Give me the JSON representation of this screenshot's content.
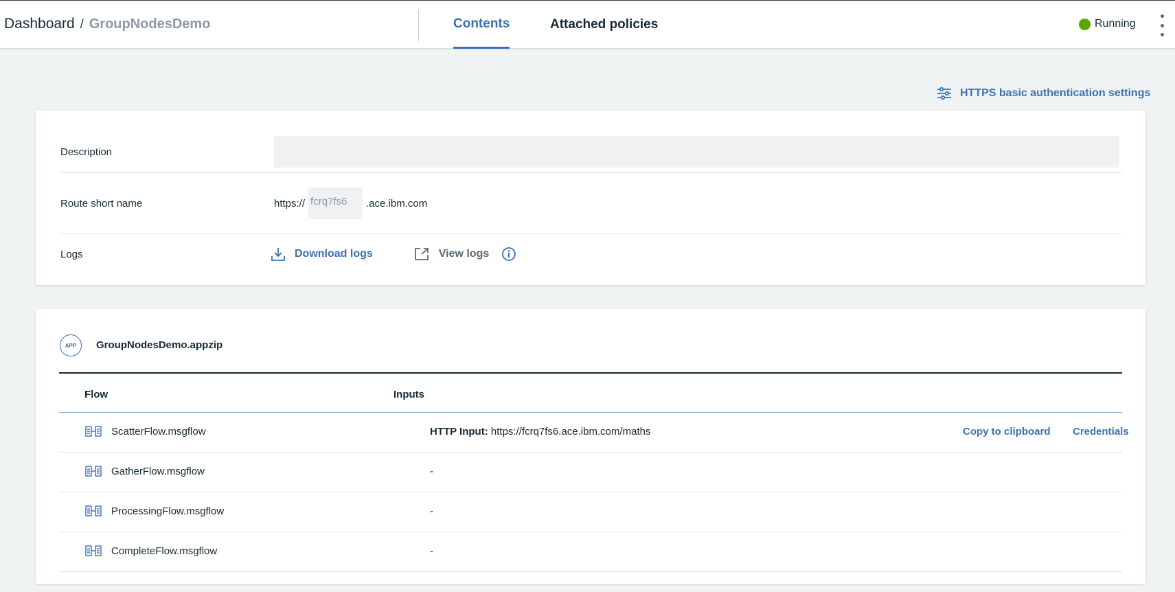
{
  "header": {
    "breadcrumb_root": "Dashboard",
    "breadcrumb_sep": "/",
    "breadcrumb_current": "GroupNodesDemo",
    "tabs": [
      {
        "label": "Contents",
        "active": true
      },
      {
        "label": "Attached policies",
        "active": false
      }
    ],
    "status_label": "Running",
    "status_color": "#5aa700"
  },
  "auth_settings_label": "HTTPS basic authentication settings",
  "details": {
    "description_label": "Description",
    "description_value": "",
    "route_label": "Route short name",
    "route_prefix": "https://",
    "route_short_name": "fcrq7fs6",
    "route_suffix": ".ace.ibm.com",
    "logs_label": "Logs",
    "download_logs": "Download logs",
    "view_logs": "View logs"
  },
  "app": {
    "badge": "APP",
    "name": "GroupNodesDemo.appzip",
    "columns": {
      "flow": "Flow",
      "inputs": "Inputs"
    },
    "flows": [
      {
        "name": "ScatterFlow.msgflow",
        "input_type": "HTTP Input:",
        "input_url": "https://fcrq7fs6.ace.ibm.com/maths",
        "copy": "Copy to clipboard",
        "credentials": "Credentials"
      },
      {
        "name": "GatherFlow.msgflow",
        "input": "-"
      },
      {
        "name": "ProcessingFlow.msgflow",
        "input": "-"
      },
      {
        "name": "CompleteFlow.msgflow",
        "input": "-"
      }
    ]
  },
  "colors": {
    "accent": "#3d70b2",
    "text": "#152935",
    "background": "#f0f3f3"
  }
}
